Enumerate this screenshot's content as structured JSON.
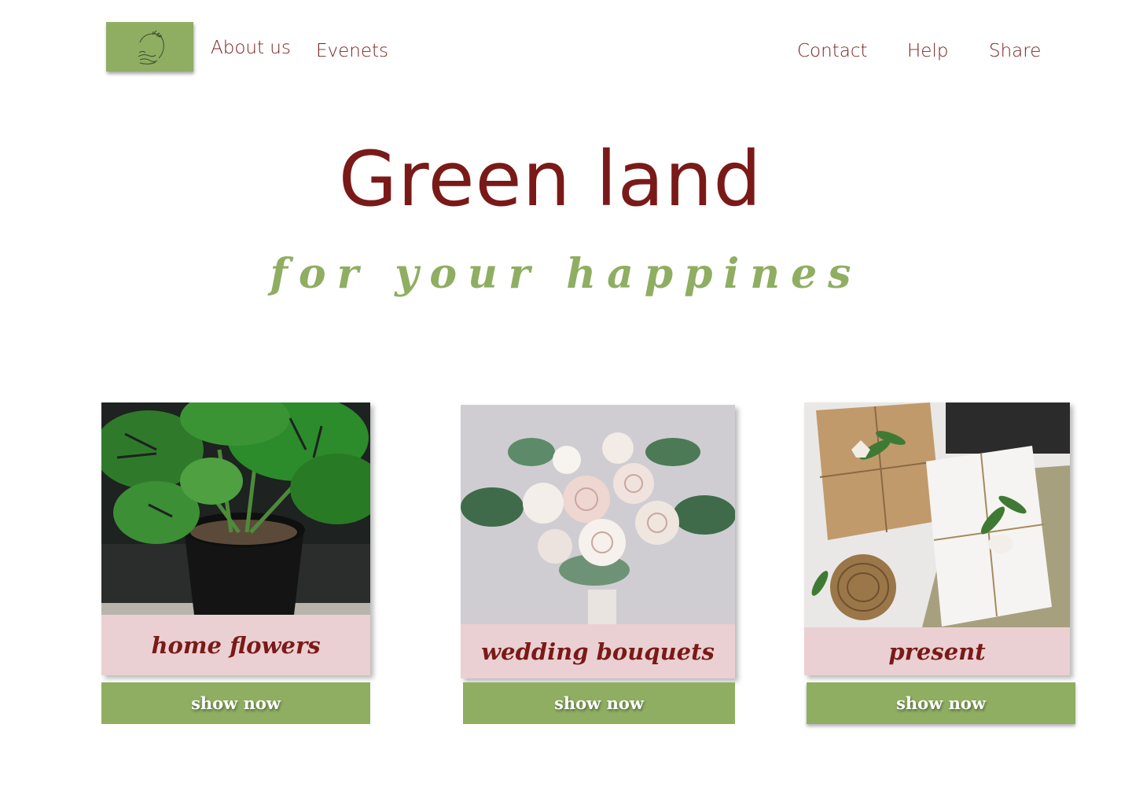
{
  "header": {
    "logo_icon": "leaf-wreath-hands-icon",
    "nav": {
      "about": "About us",
      "events": "Evenets",
      "contact": "Contact",
      "help": "Help",
      "share": "Share"
    }
  },
  "hero": {
    "title": "Green land",
    "tagline": "for your happines"
  },
  "products": [
    {
      "caption": "home flowers",
      "button": "show now",
      "image": "monstera-plant-photo"
    },
    {
      "caption": "wedding bouquets",
      "button": "show now",
      "image": "wedding-bouquet-photo"
    },
    {
      "caption": "present",
      "button": "show now",
      "image": "wrapped-gifts-photo"
    }
  ],
  "colors": {
    "brand_green": "#8fae62",
    "brand_red": "#7a1a18",
    "caption_pink": "#ead0d2"
  }
}
